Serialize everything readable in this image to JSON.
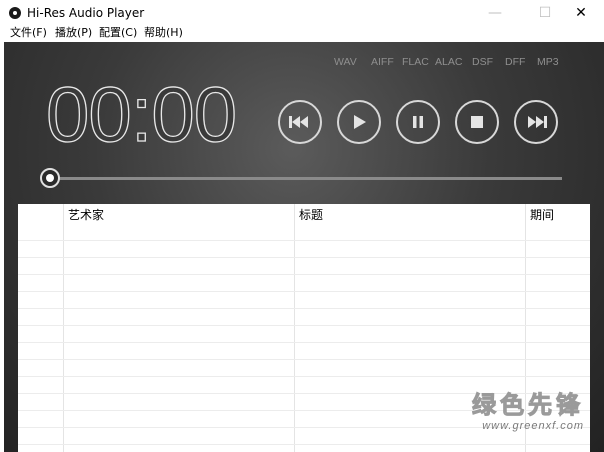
{
  "window": {
    "title": "Hi-Res Audio Player",
    "minimize_glyph": "—",
    "maximize_glyph": "☐",
    "close_glyph": "✕"
  },
  "menu": {
    "items": [
      "文件(F)",
      "播放(P)",
      "配置(C)",
      "帮助(H)"
    ]
  },
  "player": {
    "formats": [
      "WAV",
      "AIFF",
      "FLAC",
      "ALAC",
      "DSF",
      "DFF",
      "MP3"
    ],
    "time": "00:00",
    "progress": 0,
    "controls": [
      "previous-icon",
      "play-icon",
      "pause-icon",
      "stop-icon",
      "next-icon"
    ]
  },
  "playlist": {
    "columns": [
      "艺术家",
      "标题",
      "期间"
    ]
  },
  "watermark": {
    "brand": "绿色先锋",
    "url": "www.greenxf.com"
  },
  "colors": {
    "background_dark": "#222222",
    "accent_light": "#d8d8d8",
    "format_text": "#8f8f8f"
  }
}
